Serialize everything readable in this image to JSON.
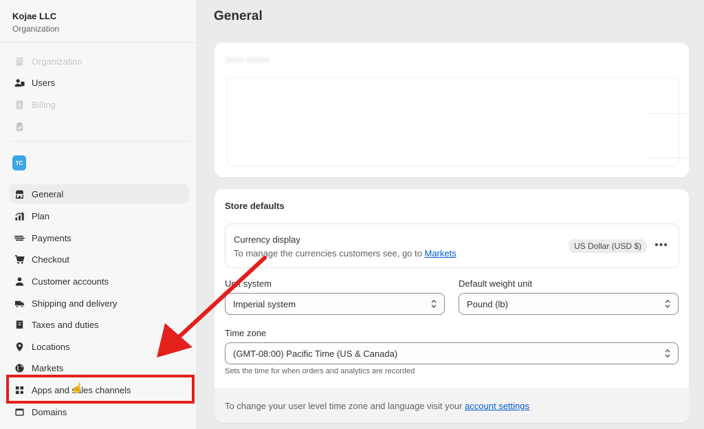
{
  "org": {
    "name": "Kojae LLC",
    "subtitle": "Organization"
  },
  "sidebar": {
    "top_items": [
      {
        "label": "Organization",
        "icon": "building-icon"
      },
      {
        "label": "Users",
        "icon": "users-icon"
      },
      {
        "label": "Billing",
        "icon": "billing-icon"
      },
      {
        "label": "",
        "icon": "clipboard-icon"
      }
    ],
    "store_avatar": "TC",
    "items": [
      {
        "label": "General",
        "icon": "store-icon"
      },
      {
        "label": "Plan",
        "icon": "plan-icon"
      },
      {
        "label": "Payments",
        "icon": "payments-icon"
      },
      {
        "label": "Checkout",
        "icon": "cart-icon"
      },
      {
        "label": "Customer accounts",
        "icon": "person-icon"
      },
      {
        "label": "Shipping and delivery",
        "icon": "truck-icon"
      },
      {
        "label": "Taxes and duties",
        "icon": "tax-icon"
      },
      {
        "label": "Locations",
        "icon": "location-icon"
      },
      {
        "label": "Markets",
        "icon": "globe-icon"
      },
      {
        "label": "Apps and sales channels",
        "icon": "apps-icon"
      },
      {
        "label": "Domains",
        "icon": "domain-icon"
      }
    ]
  },
  "main": {
    "title": "General",
    "store_details_blurred": "Store details",
    "store_defaults": {
      "title": "Store defaults",
      "currency": {
        "title": "Currency display",
        "desc_prefix": "To manage the currencies customers see, go to",
        "link": "Markets",
        "badge": "US Dollar (USD $)"
      },
      "unit_system": {
        "label": "Unit system",
        "value": "Imperial system"
      },
      "weight_unit": {
        "label": "Default weight unit",
        "value": "Pound (lb)"
      },
      "time_zone": {
        "label": "Time zone",
        "value": "(GMT-08:00) Pacific Time (US & Canada)",
        "help": "Sets the time for when orders and analytics are recorded"
      },
      "footer": {
        "prefix": "To change your user level time zone and language visit your",
        "link": "account settings"
      }
    }
  },
  "colors": {
    "annotation_red": "#e4201c",
    "link_blue": "#005bd3",
    "avatar_blue": "#3aa6e8"
  }
}
